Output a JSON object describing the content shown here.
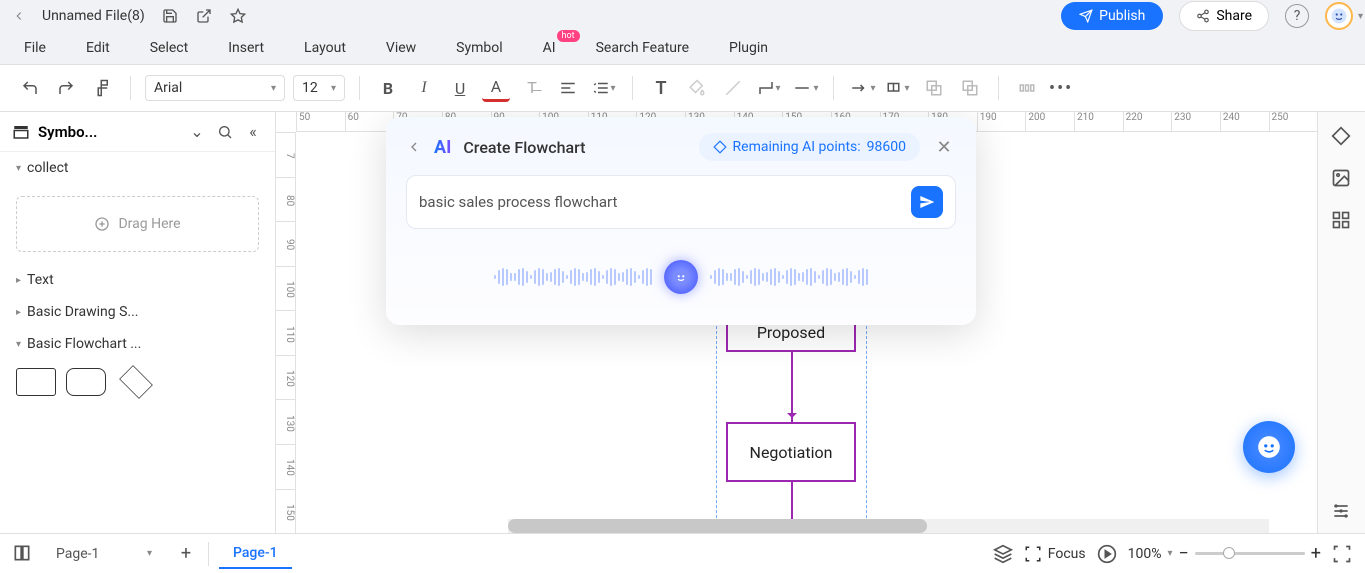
{
  "titlebar": {
    "filename": "Unnamed File(8)",
    "publish": "Publish",
    "share": "Share"
  },
  "menu": {
    "file": "File",
    "edit": "Edit",
    "select": "Select",
    "insert": "Insert",
    "layout": "Layout",
    "view": "View",
    "symbol": "Symbol",
    "ai": "AI",
    "ai_badge": "hot",
    "search": "Search Feature",
    "plugin": "Plugin"
  },
  "toolbar": {
    "font": "Arial",
    "size": "12"
  },
  "leftpanel": {
    "title": "Symbo...",
    "sections": {
      "collect": "collect",
      "drag": "Drag Here",
      "text": "Text",
      "basicdraw": "Basic Drawing S...",
      "basicflow": "Basic Flowchart ..."
    }
  },
  "ruler_top": [
    "50",
    "60",
    "70",
    "80",
    "90",
    "100",
    "110",
    "120",
    "130",
    "140",
    "150",
    "160",
    "170",
    "180",
    "190",
    "200",
    "210",
    "220",
    "230",
    "240",
    "250"
  ],
  "ruler_left": [
    "7",
    "80",
    "90",
    "100",
    "110",
    "120",
    "130",
    "140",
    "150"
  ],
  "canvas": {
    "shape1": "Proposed",
    "shape2": "Negotiation"
  },
  "ai": {
    "title": "Create Flowchart",
    "points_label": "Remaining AI points: ",
    "points_value": "98600",
    "input_value": "basic sales process flowchart"
  },
  "footer": {
    "page_select": "Page-1",
    "tab": "Page-1",
    "focus": "Focus",
    "zoom": "100%"
  }
}
